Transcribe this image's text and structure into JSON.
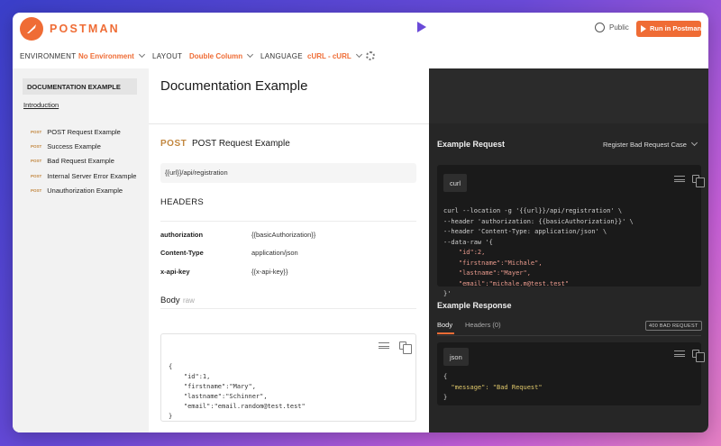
{
  "header": {
    "brand": "POSTMAN",
    "visibility": "Public",
    "run_button": "Run in Postman",
    "accent": "#ef6c35"
  },
  "toolbar": {
    "environment_label": "ENVIRONMENT",
    "environment_value": "No Environment",
    "layout_label": "LAYOUT",
    "layout_value": "Double Column",
    "language_label": "LANGUAGE",
    "language_value": "cURL - cURL"
  },
  "sidebar": {
    "title": "DOCUMENTATION EXAMPLE",
    "intro": "Introduction",
    "items": [
      {
        "method": "POST",
        "label": "POST Request Example"
      },
      {
        "method": "POST",
        "label": "Success Example"
      },
      {
        "method": "POST",
        "label": "Bad Request Example"
      },
      {
        "method": "POST",
        "label": "Internal Server Error Example"
      },
      {
        "method": "POST",
        "label": "Unauthorization Example"
      }
    ]
  },
  "main": {
    "title": "Documentation Example",
    "request": {
      "method": "POST",
      "name": "POST Request Example",
      "url": "{{url}}/api/registration",
      "headers_title": "HEADERS",
      "headers": [
        {
          "key": "authorization",
          "value": "{{basicAuthorization}}"
        },
        {
          "key": "Content-Type",
          "value": "application/json"
        },
        {
          "key": "x-api-key",
          "value": "{{x-api-key}}"
        }
      ],
      "body_title": "Body",
      "body_mode": "raw",
      "body_code": "{\n    \"id\":1,\n    \"firstname\":\"Mary\",\n    \"lastname\":\"Schinner\",\n    \"email\":\"email.random@test.test\"\n}"
    }
  },
  "example": {
    "request_title": "Example Request",
    "selected_example": "Register Bad Request Case",
    "code_tab": "curl",
    "curl_lines": [
      "curl --location -g '{{url}}/api/registration' \\",
      "--header 'authorization: {{basicAuthorization}}' \\",
      "--header 'Content-Type: application/json' \\",
      "--data-raw '{",
      "    \"id\":2,",
      "    \"firstname\":\"Michale\",",
      "    \"lastname\":\"Mayer\",",
      "    \"email\":\"michale.m@test.test\"",
      "}'"
    ],
    "response_title": "Example Response",
    "response_tabs": [
      "Body",
      "Headers (0)"
    ],
    "status": "400 BAD REQUEST",
    "response_code_tab": "json",
    "response_lines": [
      "{",
      "  \"message\": \"Bad Request\"",
      "}"
    ]
  }
}
